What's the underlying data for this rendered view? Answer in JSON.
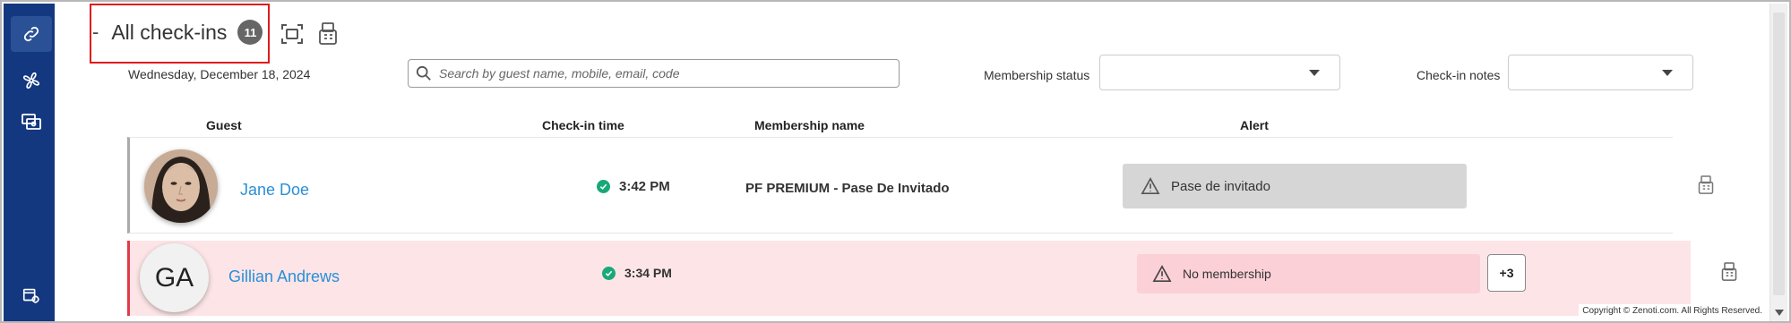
{
  "header": {
    "dash": "-",
    "title": "All check-ins",
    "count": "11",
    "date": "Wednesday, December 18, 2024"
  },
  "sidebar": {
    "items": [
      {
        "icon": "link-icon",
        "active": true
      },
      {
        "icon": "fan-icon",
        "active": false
      },
      {
        "icon": "cash-register-icon",
        "active": false
      },
      {
        "icon": "settings-store-icon",
        "active": false
      }
    ]
  },
  "search": {
    "placeholder": "Search by guest name, mobile, email, code",
    "value": ""
  },
  "filters": {
    "membership_status_label": "Membership status",
    "membership_status_value": "",
    "checkin_notes_label": "Check-in notes",
    "checkin_notes_value": ""
  },
  "columns": {
    "guest": "Guest",
    "checkin_time": "Check-in time",
    "membership_name": "Membership name",
    "alert": "Alert"
  },
  "rows": [
    {
      "name": "Jane Doe",
      "avatar": "photo",
      "time": "3:42 PM",
      "membership": "PF PREMIUM - Pase De Invitado",
      "alert": "Pase de invitado",
      "alert_color": "#d6d6d6"
    },
    {
      "name": "Gillian Andrews",
      "avatar_initials": "GA",
      "time": "3:34 PM",
      "membership": "",
      "alert": "No membership",
      "alert_color": "#fbd0d6",
      "more": "+3"
    }
  ],
  "colors": {
    "sidebar": "#14387f",
    "link": "#2a8fd6",
    "success": "#19a978",
    "error_border": "#e23a4a",
    "highlight": "#e01b1b"
  },
  "footer": {
    "copyright": "Copyright © Zenoti.com. All Rights Reserved."
  }
}
